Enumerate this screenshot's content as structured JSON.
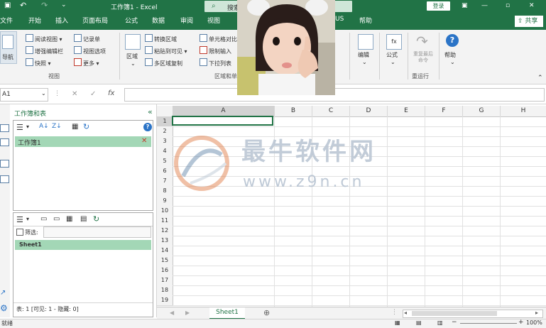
{
  "titlebar": {
    "title": "工作簿1 - Excel",
    "search_label": "搜索",
    "login": "登录",
    "undo_icon": "undo-icon",
    "redo_icon": "redo-icon",
    "minimize": "—",
    "restore": "▫",
    "close": "✕"
  },
  "tabs": [
    "文件",
    "开始",
    "插入",
    "页面布局",
    "公式",
    "数据",
    "审阅",
    "视图",
    "US",
    "帮助"
  ],
  "share": "共享",
  "ribbon": {
    "nav_label": "导航",
    "col1": [
      "阅读视图",
      "增强编辑栏",
      "快照"
    ],
    "col2": [
      "记录单",
      "视图选项",
      "更多"
    ],
    "group1_label": "视图",
    "area_label": "区域",
    "col3": [
      "转换区域",
      "粘贴到可见",
      "多区域复制"
    ],
    "col4": [
      "单元格对比",
      "限制输入",
      "下拉列表"
    ],
    "group2_label": "区域和单",
    "edit_label": "编辑",
    "formula_label": "公式",
    "repeat_label": "重复最后命令",
    "repeat_group": "重运行",
    "help_label": "帮助"
  },
  "formula_bar": {
    "namebox": "A1",
    "cancel": "✕",
    "enter": "✓",
    "fx": "fx"
  },
  "pane": {
    "title": "工作簿和表",
    "workbook": "工作簿1",
    "filter_label": "筛选:",
    "sheet": "Sheet1",
    "footer": "表: 1  [可见: 1 - 隐藏: 0]"
  },
  "grid": {
    "columns": [
      "A",
      "B",
      "C",
      "D",
      "E",
      "F",
      "G",
      "H"
    ],
    "rows": [
      "1",
      "2",
      "3",
      "4",
      "5",
      "6",
      "7",
      "8",
      "9",
      "10",
      "11",
      "12",
      "13",
      "14",
      "15",
      "16",
      "17",
      "18",
      "19"
    ]
  },
  "sheet_tab": "Sheet1",
  "status": {
    "left": "就绪",
    "zoom": "100%"
  },
  "watermark": {
    "title": "最牛软件网",
    "url": "www.z9n.cn"
  },
  "colors": {
    "excel_green": "#217346",
    "selected_green": "#a3d7b6"
  }
}
